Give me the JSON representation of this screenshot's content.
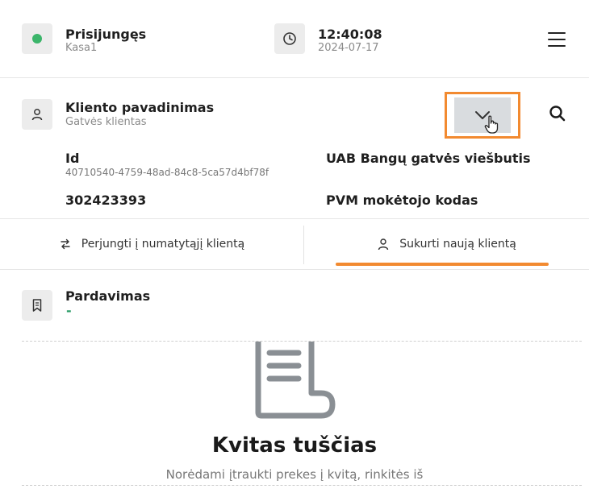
{
  "status": {
    "title": "Prisijungęs",
    "register": "Kasa1"
  },
  "clock": {
    "time": "12:40:08",
    "date": "2024-07-17"
  },
  "client": {
    "name_label": "Kliento pavadinimas",
    "name_value": "Gatvės klientas",
    "id_label": "Id",
    "id_value": "40710540-4759-48ad-84c8-5ca57d4bf78f",
    "code": "302423393",
    "company": "UAB Bangų gatvės viešbutis",
    "vat_label": "PVM mokėtojo kodas"
  },
  "actions": {
    "switch_default": "Perjungti į numatytąjį klientą",
    "create_new": "Sukurti naują klientą"
  },
  "sale": {
    "title": "Pardavimas",
    "value": "-"
  },
  "empty": {
    "title": "Kvitas tuščias",
    "description": "Norėdami įtraukti prekes į kvitą, rinkitės iš"
  },
  "colors": {
    "accent": "#f28a30",
    "online": "#3bb56a",
    "sale_dash": "#2e9e6a"
  }
}
